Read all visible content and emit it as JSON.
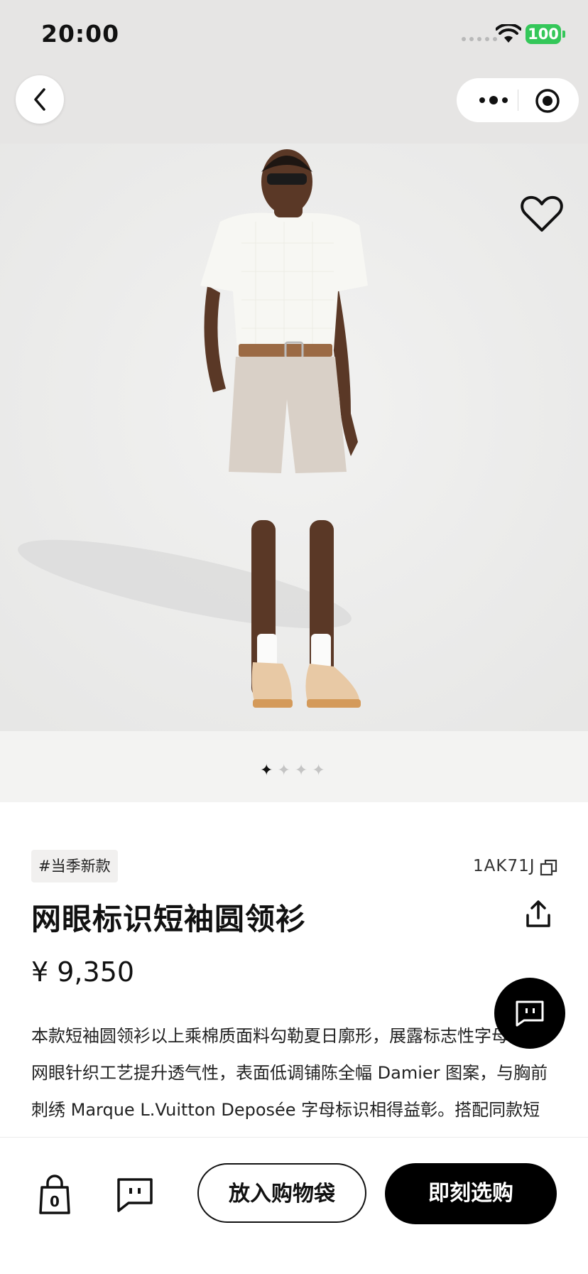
{
  "status_bar": {
    "time": "20:00",
    "battery": "100",
    "battery_color": "#34c759"
  },
  "nav": {
    "back_icon": "chevron-left-icon",
    "more_icon": "more-dots-icon",
    "target_icon": "target-icon"
  },
  "hero": {
    "image": "model-photo",
    "favorite_icon": "heart-icon",
    "carousel": {
      "count": 4,
      "active_index": 0
    }
  },
  "product": {
    "tag": "#当季新款",
    "sku": "1AK71J",
    "title": "网眼标识短袖圆领衫",
    "price": "¥ 9,350",
    "description": "本款短袖圆领衫以上乘棉质面料勾勒夏日廓形，展露标志性字母格。网眼针织工艺提升透气性，表面低调铺陈全幅 Damier 图案，与胸前刺绣 Marque L.Vuitton Deposée 字母标识相得益彰。搭配同款短裤，塑就自然风度造型。"
  },
  "bottom_bar": {
    "bag_count": "0",
    "add_to_bag": "放入购物袋",
    "buy_now": "即刻选购"
  }
}
